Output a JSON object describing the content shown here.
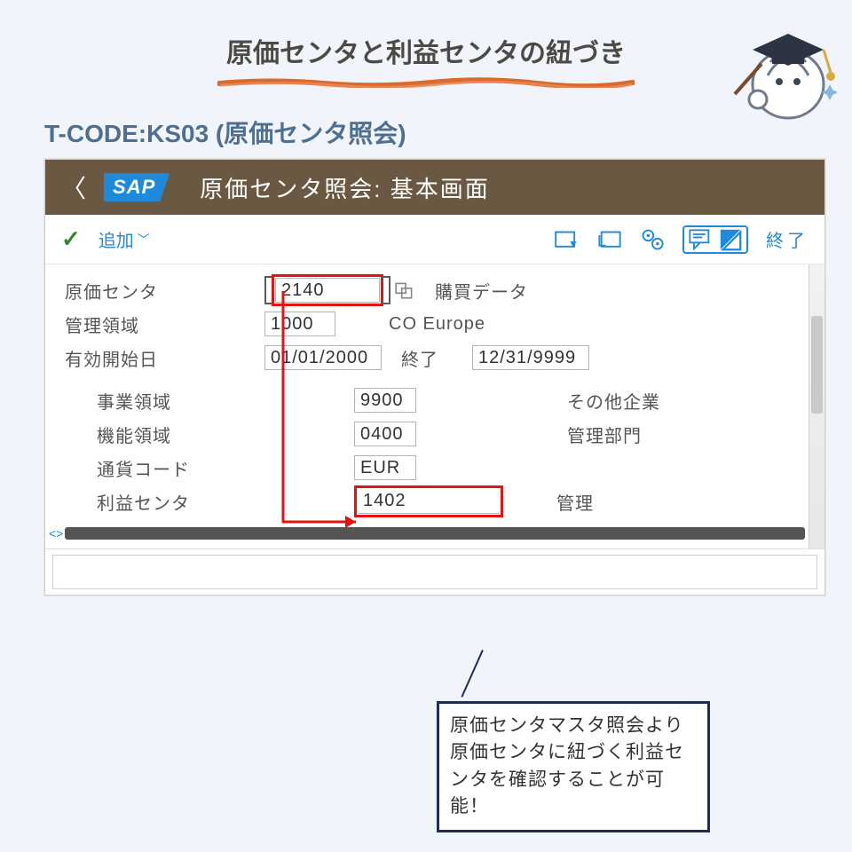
{
  "page": {
    "title": "原価センタと利益センタの紐づき",
    "tcode_line": "T-CODE:KS03 (原価センタ照会)"
  },
  "sap": {
    "header_title": "原価センタ照会: 基本画面",
    "logo": "SAP",
    "toolbar": {
      "add_label": "追加",
      "exit_label": "終了"
    },
    "fields": {
      "cost_center_label": "原価センタ",
      "cost_center_value": "2140",
      "cost_center_desc": "購買データ",
      "ctrl_area_label": "管理領域",
      "ctrl_area_value": "1000",
      "ctrl_area_desc": "CO Europe",
      "valid_from_label": "有効開始日",
      "valid_from_value": "01/01/2000",
      "valid_to_label": "終了",
      "valid_to_value": "12/31/9999",
      "biz_area_label": "事業領域",
      "biz_area_value": "9900",
      "biz_area_desc": "その他企業",
      "func_area_label": "機能領域",
      "func_area_value": "0400",
      "func_area_desc": "管理部門",
      "currency_label": "通貨コード",
      "currency_value": "EUR",
      "profit_center_label": "利益センタ",
      "profit_center_value": "1402",
      "profit_center_desc": "管理"
    }
  },
  "callout": {
    "text": "原価センタマスタ照会より原価センタに紐づく利益センタを確認することが可能！"
  }
}
